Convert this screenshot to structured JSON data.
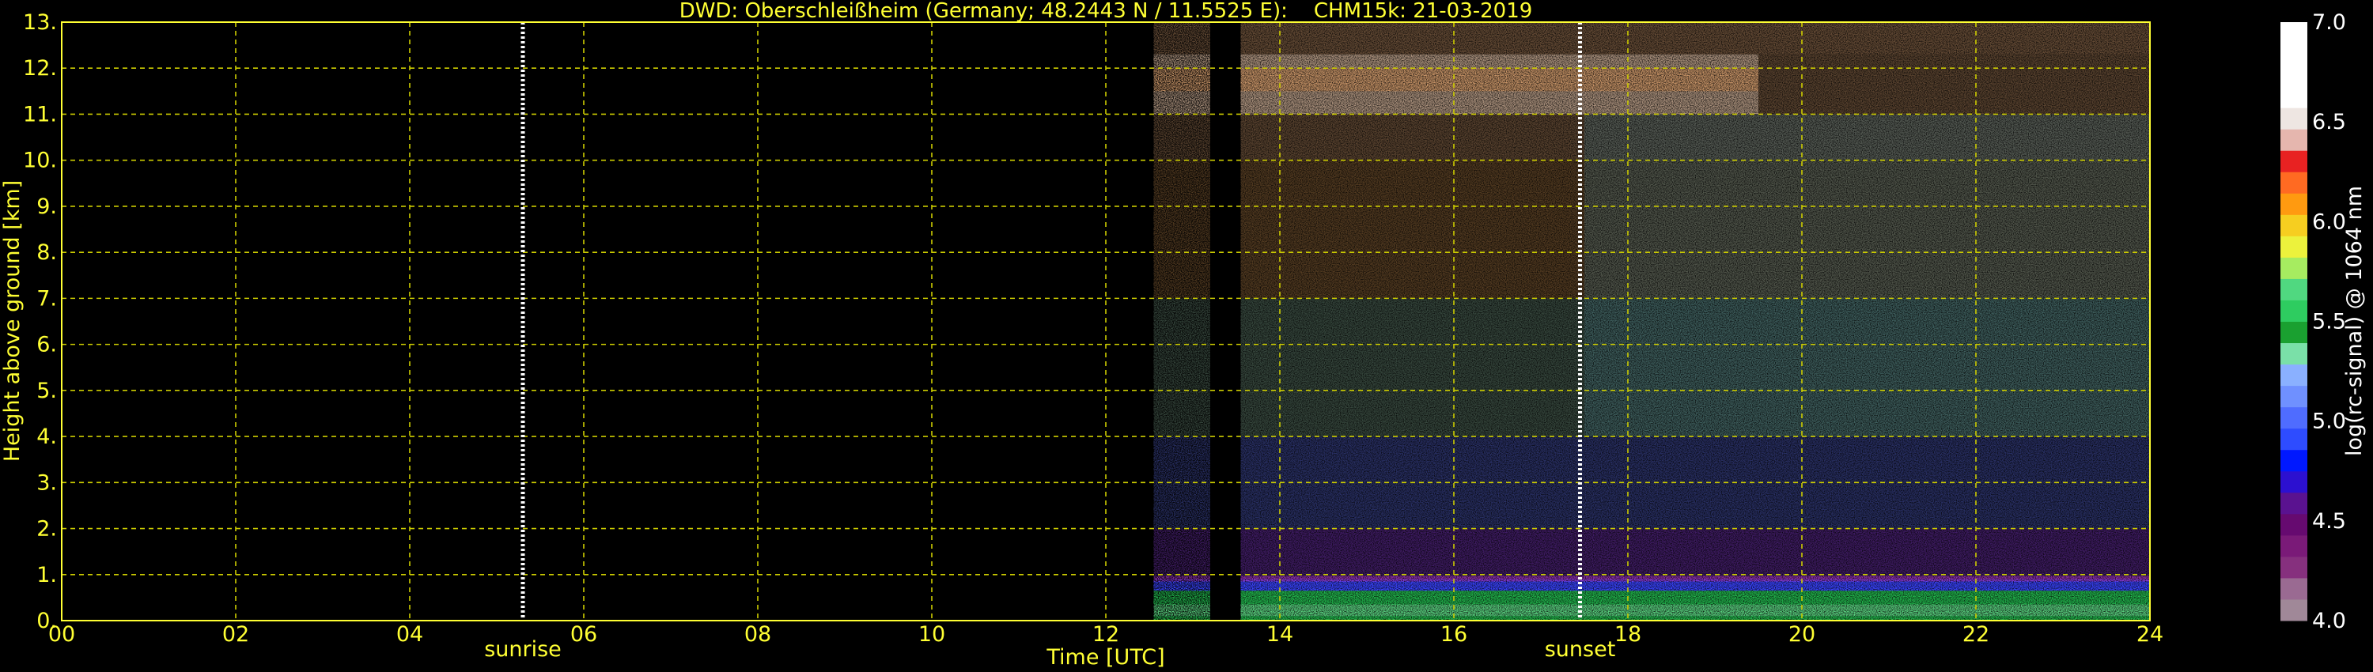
{
  "chart_data": {
    "type": "heatmap",
    "title": "DWD: Oberschleißheim (Germany; 48.2443 N / 11.5525 E):    CHM15k: 21-03-2019",
    "xlabel": "Time [UTC]",
    "ylabel": "Height above ground [km]",
    "xlim": [
      0,
      24
    ],
    "ylim": [
      0,
      13
    ],
    "x_ticks": [
      "00",
      "02",
      "04",
      "06",
      "08",
      "10",
      "12",
      "14",
      "16",
      "18",
      "20",
      "22",
      "24"
    ],
    "y_ticks": [
      "0.",
      "1.",
      "2.",
      "3.",
      "4.",
      "5.",
      "6.",
      "7.",
      "8.",
      "9.",
      "10.",
      "11.",
      "12.",
      "13."
    ],
    "grid": true,
    "data_start_time": 12.55,
    "data_gap": [
      13.2,
      13.55
    ],
    "data_end_time": 24,
    "sunrise": {
      "label": "sunrise",
      "time": 5.3
    },
    "sunset": {
      "label": "sunset",
      "time": 17.45
    },
    "colorbar": {
      "label": "log(rc-signal) @ 1064 nm",
      "range": [
        4.0,
        7.0
      ],
      "ticks": [
        "4.0",
        "4.5",
        "5.0",
        "5.5",
        "6.0",
        "6.5",
        "7.0"
      ]
    },
    "features": [
      {
        "name": "boundary-layer aerosol",
        "time": [
          12.55,
          24
        ],
        "height_km": [
          0,
          0.9
        ],
        "level": 5.0
      },
      {
        "name": "cirrus",
        "time": [
          12.55,
          19.5
        ],
        "height_km": [
          11,
          12.3
        ],
        "level": 6.0
      }
    ]
  },
  "colors": {
    "text": "#ffff33",
    "grid": "#cccc00",
    "background": "#000000",
    "colorbar": [
      "#a08898",
      "#9a6a92",
      "#86307e",
      "#7a1a78",
      "#660a70",
      "#5a1290",
      "#2c10d0",
      "#0018ff",
      "#2e4cff",
      "#4f6cff",
      "#6f90ff",
      "#8ab0ff",
      "#7ae0a8",
      "#1aa030",
      "#2ecc60",
      "#50d880",
      "#a6ec60",
      "#ecf23c",
      "#f6ce20",
      "#ff9a10",
      "#ff6a22",
      "#e82222",
      "#e5b6ae",
      "#eee6e2",
      "#ffffff",
      "#ffffff",
      "#ffffff",
      "#ffffff"
    ]
  }
}
